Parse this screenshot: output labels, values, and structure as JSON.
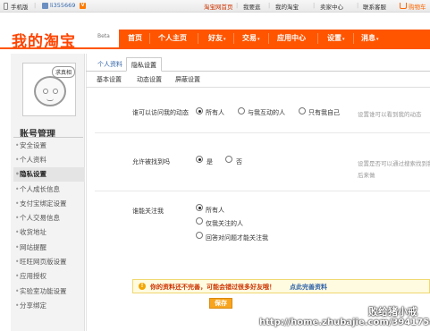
{
  "topbar": {
    "phone": "手机版",
    "user_id": "li355669",
    "vip": "V",
    "home": "淘宝网首页",
    "my_taobao": "我的淘宝",
    "favorites": "我要逛",
    "seller_center": "卖家中心",
    "service": "联系客服",
    "cart": "购物车"
  },
  "logo": {
    "text": "我的淘宝",
    "badge": "Beta"
  },
  "nav": {
    "items": [
      "首页",
      "个人主页",
      "好友",
      "交易",
      "应用中心",
      "设置",
      "消息"
    ],
    "caret": "▾"
  },
  "sidebar": {
    "avatar_bubble": "求真相",
    "title": "账号管理",
    "items": [
      "安全设置",
      "个人资料",
      "隐私设置",
      "个人成长信息",
      "支付宝绑定设置",
      "个人交易信息",
      "收货地址",
      "网站提醒",
      "旺旺网页版设置",
      "应用授权",
      "实验室功能设置",
      "分享绑定"
    ]
  },
  "tabs": {
    "items": [
      "个人资料",
      "隐私设置"
    ]
  },
  "subtabs": {
    "items": [
      "基本设置",
      "动态设置",
      "屏蔽设置"
    ]
  },
  "settings": {
    "dynamic": {
      "label": "谁可以访问我的动态",
      "options": [
        "所有人",
        "与我互动的人",
        "只有我自己"
      ],
      "hint": "设置谁可以看到我的动态"
    },
    "search": {
      "label": "允许被找到吗",
      "options": [
        "是",
        "否"
      ],
      "hint1": "设置是否可以通过搜索找到我",
      "hint2": "后来做"
    },
    "follow": {
      "label": "谁能关注我",
      "options": [
        "所有人",
        "仅我关注的人",
        "回答对问题才能关注我"
      ]
    }
  },
  "notice": {
    "icon": "!",
    "text": "你的资料还不完善，可能会错过很多好友哦！",
    "link": "点此完善资料"
  },
  "save_label": "保存",
  "watermark": {
    "line1": "败给猪小戒",
    "line2": "http://home.zhubajie.com/3941754/"
  },
  "colors": {
    "brand": "#ff5500",
    "link": "#3366aa",
    "warn": "#cc3300"
  }
}
